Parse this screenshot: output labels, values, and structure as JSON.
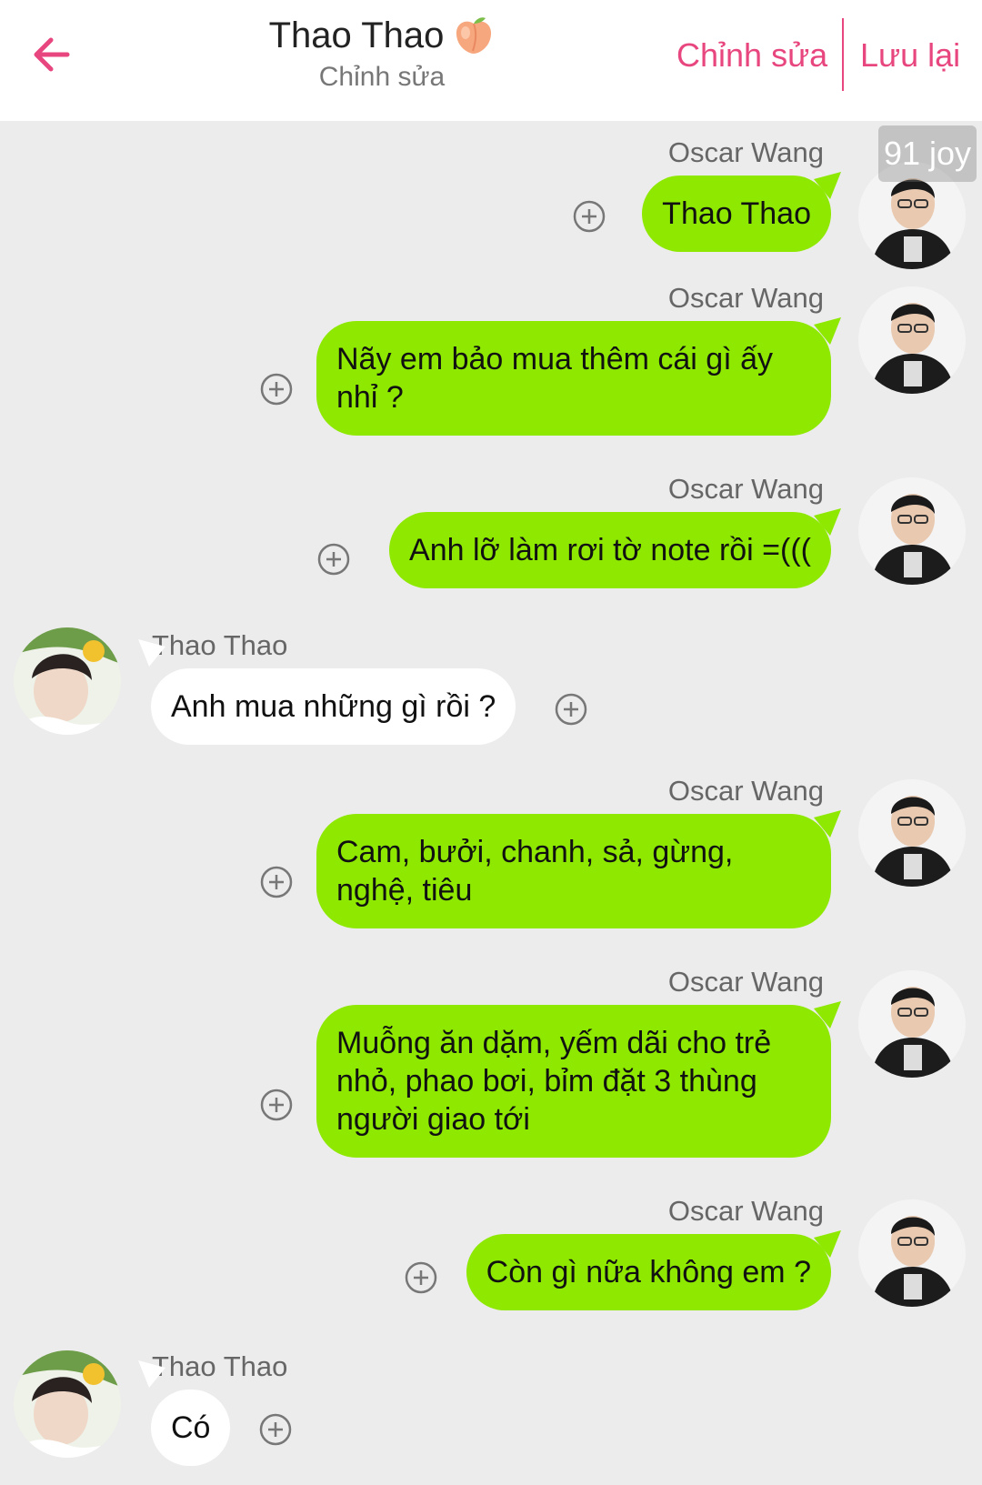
{
  "header": {
    "title": "Thao Thao",
    "title_emoji": "peach-icon",
    "subtitle": "Chỉnh sửa",
    "edit_label": "Chỉnh sửa",
    "save_label": "Lưu lại"
  },
  "colors": {
    "accent": "#e8467e",
    "outgoing_bubble": "#8ee800",
    "incoming_bubble": "#ffffff",
    "background": "#ececec"
  },
  "watermark": "91 joy",
  "messages": [
    {
      "direction": "out",
      "sender": "Oscar Wang",
      "text": "Thao Thao"
    },
    {
      "direction": "out",
      "sender": "Oscar Wang",
      "text": "Nãy em bảo mua thêm cái gì ấy nhỉ ?"
    },
    {
      "direction": "out",
      "sender": "Oscar Wang",
      "text": "Anh lỡ làm rơi tờ note rồi =((("
    },
    {
      "direction": "in",
      "sender": "Thao Thao",
      "text": "Anh mua những gì rồi ?"
    },
    {
      "direction": "out",
      "sender": "Oscar Wang",
      "text": "Cam, bưởi, chanh, sả, gừng, nghệ, tiêu"
    },
    {
      "direction": "out",
      "sender": "Oscar Wang",
      "text": "Muỗng ăn dặm, yếm dãi cho trẻ nhỏ, phao bơi, bỉm đặt 3 thùng người giao tới"
    },
    {
      "direction": "out",
      "sender": "Oscar Wang",
      "text": "Còn gì nữa không em ?"
    },
    {
      "direction": "in",
      "sender": "Thao Thao",
      "text": "Có"
    }
  ]
}
